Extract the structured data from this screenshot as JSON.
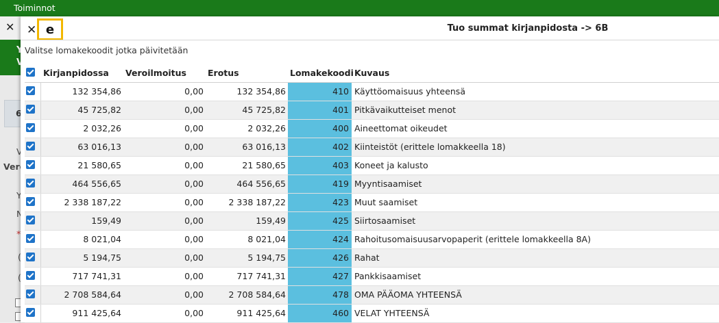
{
  "app": {
    "title": "Toiminnot"
  },
  "background": {
    "green_letters": [
      "Y",
      "V"
    ],
    "box_letter": "6",
    "side_labels": [
      "V",
      "Vero",
      "Y",
      "N",
      "*",
      "(",
      "("
    ]
  },
  "dialog": {
    "title": "Tuo summat kirjanpidosta -> 6B",
    "subtitle": "Valitse lomakekoodit jotka päivitetään",
    "columns": {
      "kirjanpidossa": "Kirjanpidossa",
      "veroilmoitus": "Veroilmoitus",
      "erotus": "Erotus",
      "lomakekoodi": "Lomakekoodi",
      "kuvaus": "Kuvaus"
    },
    "rows": [
      {
        "kirjanpidossa": "132 354,86",
        "veroilmoitus": "0,00",
        "erotus": "132 354,86",
        "koodi": "410",
        "kuvaus": "Käyttöomaisuus yhteensä",
        "checked": true
      },
      {
        "kirjanpidossa": "45 725,82",
        "veroilmoitus": "0,00",
        "erotus": "45 725,82",
        "koodi": "401",
        "kuvaus": "Pitkävaikutteiset menot",
        "checked": true
      },
      {
        "kirjanpidossa": "2 032,26",
        "veroilmoitus": "0,00",
        "erotus": "2 032,26",
        "koodi": "400",
        "kuvaus": "Aineettomat oikeudet",
        "checked": true
      },
      {
        "kirjanpidossa": "63 016,13",
        "veroilmoitus": "0,00",
        "erotus": "63 016,13",
        "koodi": "402",
        "kuvaus": "Kiinteistöt (erittele lomakkeella 18)",
        "checked": true
      },
      {
        "kirjanpidossa": "21 580,65",
        "veroilmoitus": "0,00",
        "erotus": "21 580,65",
        "koodi": "403",
        "kuvaus": "Koneet ja kalusto",
        "checked": true
      },
      {
        "kirjanpidossa": "464 556,65",
        "veroilmoitus": "0,00",
        "erotus": "464 556,65",
        "koodi": "419",
        "kuvaus": "Myyntisaamiset",
        "checked": true
      },
      {
        "kirjanpidossa": "2 338 187,22",
        "veroilmoitus": "0,00",
        "erotus": "2 338 187,22",
        "koodi": "423",
        "kuvaus": "Muut saamiset",
        "checked": true
      },
      {
        "kirjanpidossa": "159,49",
        "veroilmoitus": "0,00",
        "erotus": "159,49",
        "koodi": "425",
        "kuvaus": "Siirtosaamiset",
        "checked": true
      },
      {
        "kirjanpidossa": "8 021,04",
        "veroilmoitus": "0,00",
        "erotus": "8 021,04",
        "koodi": "424",
        "kuvaus": "Rahoitusomaisuusarvopaperit (erittele lomakkeella 8A)",
        "checked": true
      },
      {
        "kirjanpidossa": "5 194,75",
        "veroilmoitus": "0,00",
        "erotus": "5 194,75",
        "koodi": "426",
        "kuvaus": "Rahat",
        "checked": true
      },
      {
        "kirjanpidossa": "717 741,31",
        "veroilmoitus": "0,00",
        "erotus": "717 741,31",
        "koodi": "427",
        "kuvaus": "Pankkisaamiset",
        "checked": true
      },
      {
        "kirjanpidossa": "2 708 584,64",
        "veroilmoitus": "0,00",
        "erotus": "2 708 584,64",
        "koodi": "478",
        "kuvaus": "OMA PÄÄOMA YHTEENSÄ",
        "checked": true
      },
      {
        "kirjanpidossa": "911 425,64",
        "veroilmoitus": "0,00",
        "erotus": "911 425,64",
        "koodi": "460",
        "kuvaus": "VELAT YHTEENSÄ",
        "checked": true
      }
    ]
  },
  "colors": {
    "header_green": "#1a7a1a",
    "code_cell": "#5bbfdf",
    "checkbox": "#1e73c8",
    "highlight": "#f2b700"
  },
  "icons": {
    "close": "close-icon",
    "action": "import-icon",
    "checkbox": "checkbox-checked-icon"
  }
}
